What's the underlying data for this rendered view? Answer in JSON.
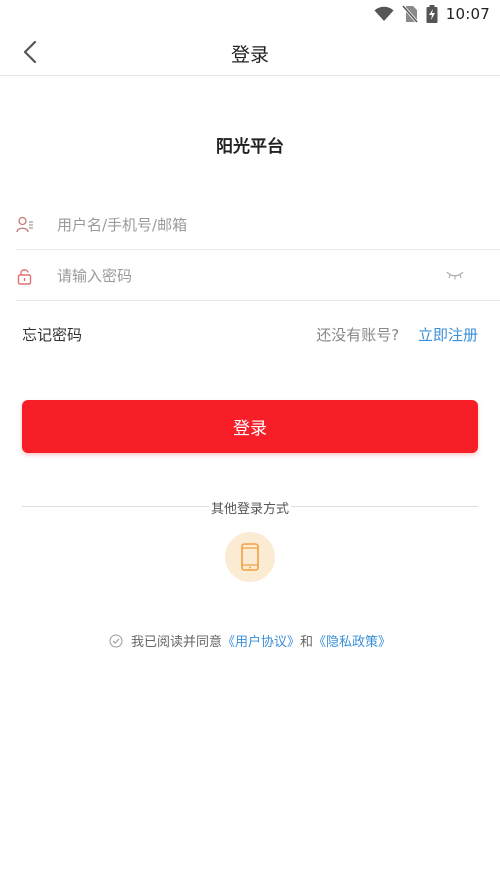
{
  "status": {
    "time": "10:07"
  },
  "nav": {
    "title": "登录"
  },
  "brand": {
    "name": "阳光平台"
  },
  "form": {
    "username_placeholder": "用户名/手机号/邮箱",
    "password_placeholder": "请输入密码"
  },
  "links": {
    "forgot": "忘记密码",
    "no_account": "还没有账号?",
    "register": "立即注册"
  },
  "login_button": "登录",
  "other_login": {
    "label": "其他登录方式"
  },
  "agreement": {
    "prefix": "我已阅读并同意",
    "user_agreement": "《用户协议》",
    "and": "和",
    "privacy_policy": "《隐私政策》"
  },
  "colors": {
    "primary": "#f71e28",
    "link": "#3a8fd9",
    "phone_icon_bg": "#fcebd3",
    "phone_icon": "#f0a040",
    "lock_icon": "#e07070"
  },
  "icons": {
    "back": "chevron-left-icon",
    "user": "user-icon",
    "lock": "lock-icon",
    "eye": "eye-closed-icon",
    "phone": "phone-icon",
    "check": "check-circle-icon"
  }
}
